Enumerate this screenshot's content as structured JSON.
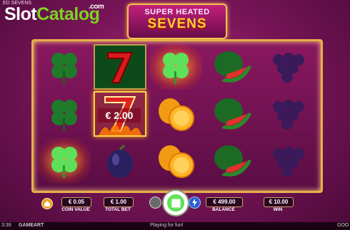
{
  "window": {
    "title_fragment": "ED SEVENS"
  },
  "watermark": {
    "part1": "Slot",
    "part2": "Catalog",
    "suffix": ".com"
  },
  "game_title": {
    "line1": "SUPER HEATED",
    "line2": "SEVENS"
  },
  "reels": [
    [
      "four-leaf-clover",
      "four-leaf-clover",
      "four-leaf-clover-glowing"
    ],
    [
      "red-seven",
      "red-seven-flaming",
      "plum"
    ],
    [
      "four-leaf-clover-glowing",
      "orange",
      "orange"
    ],
    [
      "watermelon",
      "watermelon",
      "watermelon"
    ],
    [
      "grapes",
      "grapes",
      "grapes"
    ]
  ],
  "win_prize": "€ 2.00",
  "controls": {
    "coin_value": {
      "value": "€ 0.05",
      "label": "COIN VALUE"
    },
    "total_bet": {
      "value": "€ 1.00",
      "label": "TOTAL BET"
    },
    "balance": {
      "value": "€ 499.00",
      "label": "BALANCE"
    },
    "win": {
      "value": "€ 10.00",
      "label": "WIN"
    }
  },
  "footer": {
    "time": "3:39",
    "provider": "GAMEART",
    "status": "Playing for fun!",
    "right": "GOO"
  },
  "colors": {
    "accent_gold": "#e8b04a",
    "spin_green": "#2ecc40",
    "background": "#7a1558"
  }
}
